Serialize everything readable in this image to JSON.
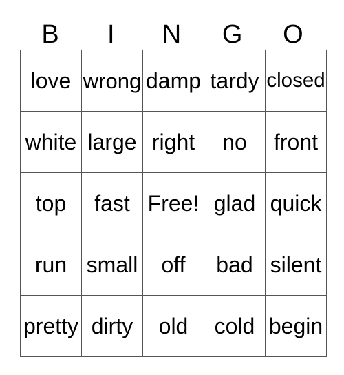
{
  "header": [
    "B",
    "I",
    "N",
    "G",
    "O"
  ],
  "rows": [
    [
      "love",
      "wrong",
      "damp",
      "tardy",
      "closed"
    ],
    [
      "white",
      "large",
      "right",
      "no",
      "front"
    ],
    [
      "top",
      "fast",
      "Free!",
      "glad",
      "quick"
    ],
    [
      "run",
      "small",
      "off",
      "bad",
      "silent"
    ],
    [
      "pretty",
      "dirty",
      "old",
      "cold",
      "begin"
    ]
  ]
}
